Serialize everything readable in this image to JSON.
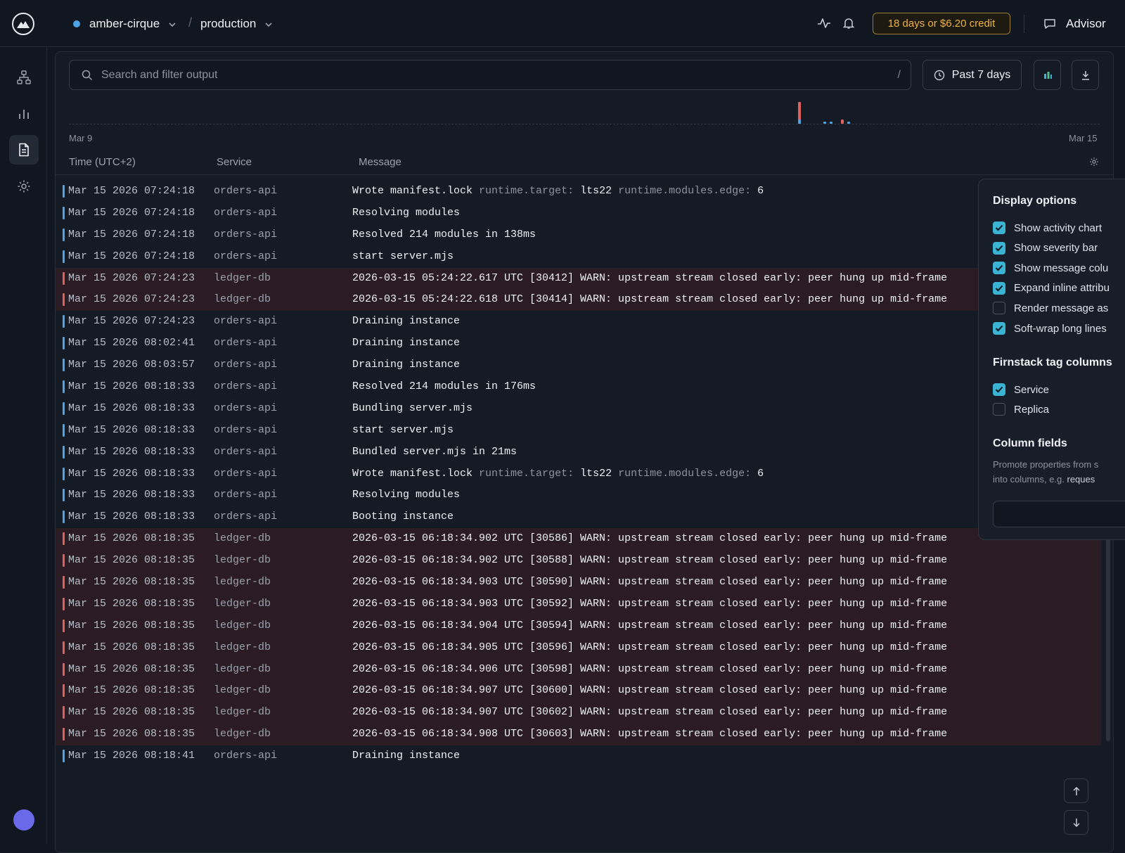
{
  "header": {
    "project": "amber-cirque",
    "environment": "production",
    "credit": "18 days or $6.20 credit",
    "advisor": "Advisor"
  },
  "toolbar": {
    "search_placeholder": "Search and filter output",
    "search_shortcut": "/",
    "time_range": "Past 7 days"
  },
  "activity": {
    "start_label": "Mar 9",
    "end_label": "Mar 15"
  },
  "columns": {
    "time": "Time (UTC+2)",
    "service": "Service",
    "message": "Message"
  },
  "colors": {
    "info": "#4ea2e6",
    "warn": "#e0605d",
    "accent": "#3bb4d4",
    "credit": "#f0b33d"
  },
  "logs": [
    {
      "level": "info",
      "time": "Mar 15 2026 07:24:18",
      "service": "orders-api",
      "message": "Wrote manifest.lock",
      "attr1_key": "runtime.target:",
      "attr1_val": "lts22",
      "attr2_key": "runtime.modules.edge:",
      "attr2_val": "6"
    },
    {
      "level": "info",
      "time": "Mar 15 2026 07:24:18",
      "service": "orders-api",
      "message": "Resolving modules"
    },
    {
      "level": "info",
      "time": "Mar 15 2026 07:24:18",
      "service": "orders-api",
      "message": "Resolved 214 modules in 138ms"
    },
    {
      "level": "info",
      "time": "Mar 15 2026 07:24:18",
      "service": "orders-api",
      "message": "start server.mjs"
    },
    {
      "level": "warn",
      "time": "Mar 15 2026 07:24:23",
      "service": "ledger-db",
      "message": "2026-03-15 05:24:22.617 UTC [30412] WARN: upstream stream closed early: peer hung up mid-frame"
    },
    {
      "level": "warn",
      "time": "Mar 15 2026 07:24:23",
      "service": "ledger-db",
      "message": "2026-03-15 05:24:22.618 UTC [30414] WARN: upstream stream closed early: peer hung up mid-frame"
    },
    {
      "level": "info",
      "time": "Mar 15 2026 07:24:23",
      "service": "orders-api",
      "message": "Draining instance"
    },
    {
      "level": "info",
      "time": "Mar 15 2026 08:02:41",
      "service": "orders-api",
      "message": "Draining instance"
    },
    {
      "level": "info",
      "time": "Mar 15 2026 08:03:57",
      "service": "orders-api",
      "message": "Draining instance"
    },
    {
      "level": "info",
      "time": "Mar 15 2026 08:18:33",
      "service": "orders-api",
      "message": "Resolved 214 modules in 176ms"
    },
    {
      "level": "info",
      "time": "Mar 15 2026 08:18:33",
      "service": "orders-api",
      "message": "Bundling server.mjs"
    },
    {
      "level": "info",
      "time": "Mar 15 2026 08:18:33",
      "service": "orders-api",
      "message": "start server.mjs"
    },
    {
      "level": "info",
      "time": "Mar 15 2026 08:18:33",
      "service": "orders-api",
      "message": "Bundled server.mjs in 21ms"
    },
    {
      "level": "info",
      "time": "Mar 15 2026 08:18:33",
      "service": "orders-api",
      "message": "Wrote manifest.lock",
      "attr1_key": "runtime.target:",
      "attr1_val": "lts22",
      "attr2_key": "runtime.modules.edge:",
      "attr2_val": "6"
    },
    {
      "level": "info",
      "time": "Mar 15 2026 08:18:33",
      "service": "orders-api",
      "message": "Resolving modules"
    },
    {
      "level": "info",
      "time": "Mar 15 2026 08:18:33",
      "service": "orders-api",
      "message": "Booting instance"
    },
    {
      "level": "warn",
      "time": "Mar 15 2026 08:18:35",
      "service": "ledger-db",
      "message": "2026-03-15 06:18:34.902 UTC [30586] WARN: upstream stream closed early: peer hung up mid-frame"
    },
    {
      "level": "warn",
      "time": "Mar 15 2026 08:18:35",
      "service": "ledger-db",
      "message": "2026-03-15 06:18:34.902 UTC [30588] WARN: upstream stream closed early: peer hung up mid-frame"
    },
    {
      "level": "warn",
      "time": "Mar 15 2026 08:18:35",
      "service": "ledger-db",
      "message": "2026-03-15 06:18:34.903 UTC [30590] WARN: upstream stream closed early: peer hung up mid-frame"
    },
    {
      "level": "warn",
      "time": "Mar 15 2026 08:18:35",
      "service": "ledger-db",
      "message": "2026-03-15 06:18:34.903 UTC [30592] WARN: upstream stream closed early: peer hung up mid-frame"
    },
    {
      "level": "warn",
      "time": "Mar 15 2026 08:18:35",
      "service": "ledger-db",
      "message": "2026-03-15 06:18:34.904 UTC [30594] WARN: upstream stream closed early: peer hung up mid-frame"
    },
    {
      "level": "warn",
      "time": "Mar 15 2026 08:18:35",
      "service": "ledger-db",
      "message": "2026-03-15 06:18:34.905 UTC [30596] WARN: upstream stream closed early: peer hung up mid-frame"
    },
    {
      "level": "warn",
      "time": "Mar 15 2026 08:18:35",
      "service": "ledger-db",
      "message": "2026-03-15 06:18:34.906 UTC [30598] WARN: upstream stream closed early: peer hung up mid-frame"
    },
    {
      "level": "warn",
      "time": "Mar 15 2026 08:18:35",
      "service": "ledger-db",
      "message": "2026-03-15 06:18:34.907 UTC [30600] WARN: upstream stream closed early: peer hung up mid-frame"
    },
    {
      "level": "warn",
      "time": "Mar 15 2026 08:18:35",
      "service": "ledger-db",
      "message": "2026-03-15 06:18:34.907 UTC [30602] WARN: upstream stream closed early: peer hung up mid-frame"
    },
    {
      "level": "warn",
      "time": "Mar 15 2026 08:18:35",
      "service": "ledger-db",
      "message": "2026-03-15 06:18:34.908 UTC [30603] WARN: upstream stream closed early: peer hung up mid-frame"
    },
    {
      "level": "info",
      "time": "Mar 15 2026 08:18:41",
      "service": "orders-api",
      "message": "Draining instance"
    }
  ],
  "display_options": {
    "title": "Display options",
    "items": [
      {
        "label": "Show activity chart",
        "checked": true
      },
      {
        "label": "Show severity bar",
        "checked": true
      },
      {
        "label": "Show message colu",
        "checked": true
      },
      {
        "label": "Expand inline attribu",
        "checked": true
      },
      {
        "label": "Render message as",
        "checked": false
      },
      {
        "label": "Soft-wrap long lines",
        "checked": true
      }
    ]
  },
  "tag_columns": {
    "title": "Firnstack tag columns",
    "items": [
      {
        "label": "Service",
        "checked": true
      },
      {
        "label": "Replica",
        "checked": false
      }
    ]
  },
  "column_fields": {
    "title": "Column fields",
    "help_line1": "Promote properties from s",
    "help_line2_prefix": "into columns, e.g. ",
    "help_line2_code": "reques"
  }
}
